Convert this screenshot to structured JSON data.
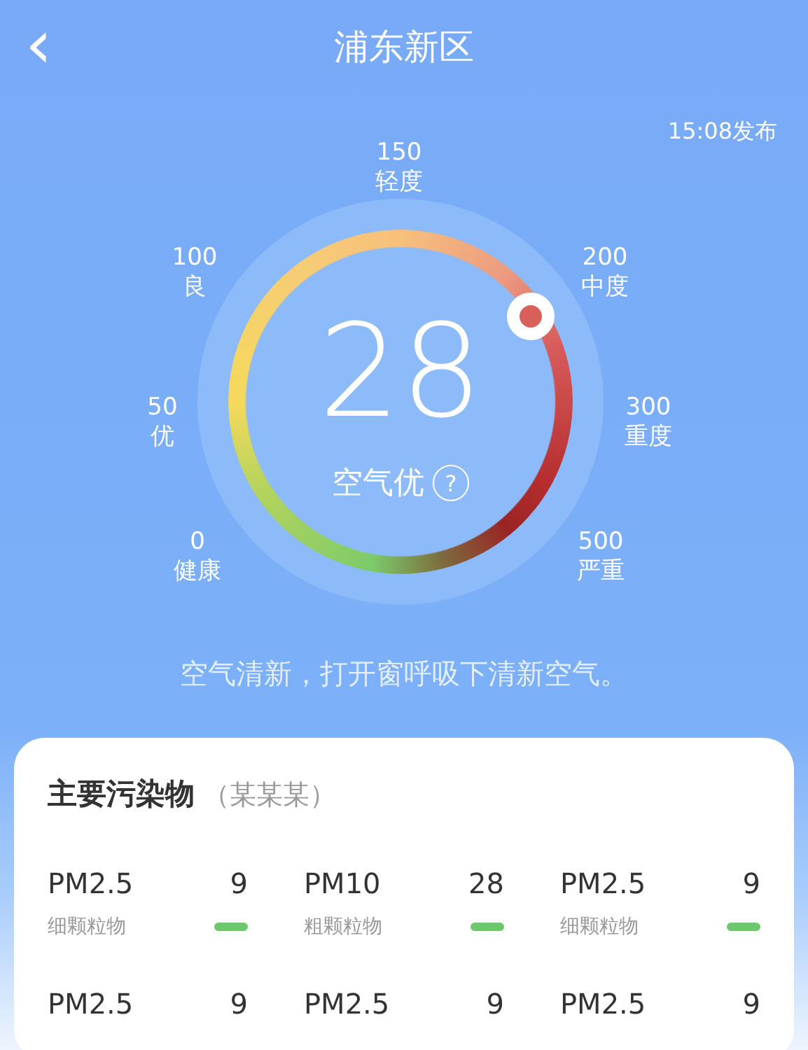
{
  "header": {
    "back_icon": "‹",
    "title": "浦东新区",
    "published": "15:08发布"
  },
  "gauge": {
    "value": "28",
    "status": "空气优",
    "help": "?",
    "scale": [
      {
        "value": "0",
        "label": "健康"
      },
      {
        "value": "50",
        "label": "优"
      },
      {
        "value": "100",
        "label": "良"
      },
      {
        "value": "150",
        "label": "轻度"
      },
      {
        "value": "200",
        "label": "中度"
      },
      {
        "value": "300",
        "label": "重度"
      },
      {
        "value": "500",
        "label": "严重"
      }
    ]
  },
  "advice": "空气清新，打开窗呼吸下清新空气。",
  "pollutants": {
    "title": "主要污染物",
    "subtitle": "（某某某）",
    "items": [
      {
        "name": "PM2.5",
        "value": "9",
        "desc": "细颗粒物"
      },
      {
        "name": "PM10",
        "value": "28",
        "desc": "粗颗粒物"
      },
      {
        "name": "PM2.5",
        "value": "9",
        "desc": "细颗粒物"
      },
      {
        "name": "PM2.5",
        "value": "9"
      },
      {
        "name": "PM2.5",
        "value": "9"
      },
      {
        "name": "PM2.5",
        "value": "9"
      }
    ]
  }
}
